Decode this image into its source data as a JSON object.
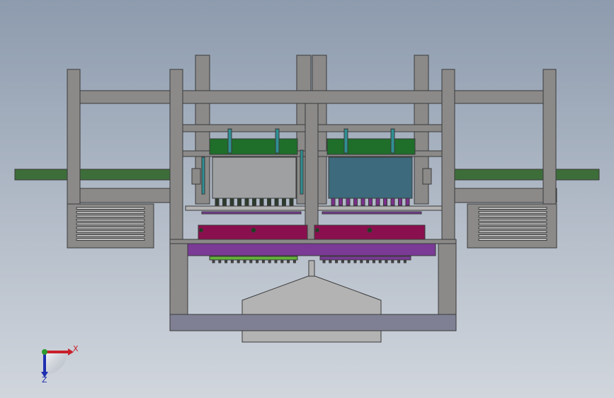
{
  "view": {
    "background_top": "#8d9bae",
    "background_bottom": "#d1d6dd"
  },
  "colors": {
    "frame": "#8b8a89",
    "frame_dark": "#6f6e6e",
    "frame_edge": "#3a3a3a",
    "conveyor": "#3d6e3a",
    "belt_green": "#1f6e2a",
    "gray_block": "#9fa0a2",
    "teal_block": "#3d6a7c",
    "teal_rod": "#2f8f93",
    "magenta": "#8a0f4e",
    "purple": "#7a3a95",
    "lime": "#63b23a",
    "light_gray": "#b3b3b3",
    "slate": "#7f8094"
  },
  "triad": {
    "x_label": "X",
    "z_label": "Z",
    "x_color": "#c8202a",
    "y_color": "#2e9b2e",
    "z_color": "#1f2fb0"
  }
}
